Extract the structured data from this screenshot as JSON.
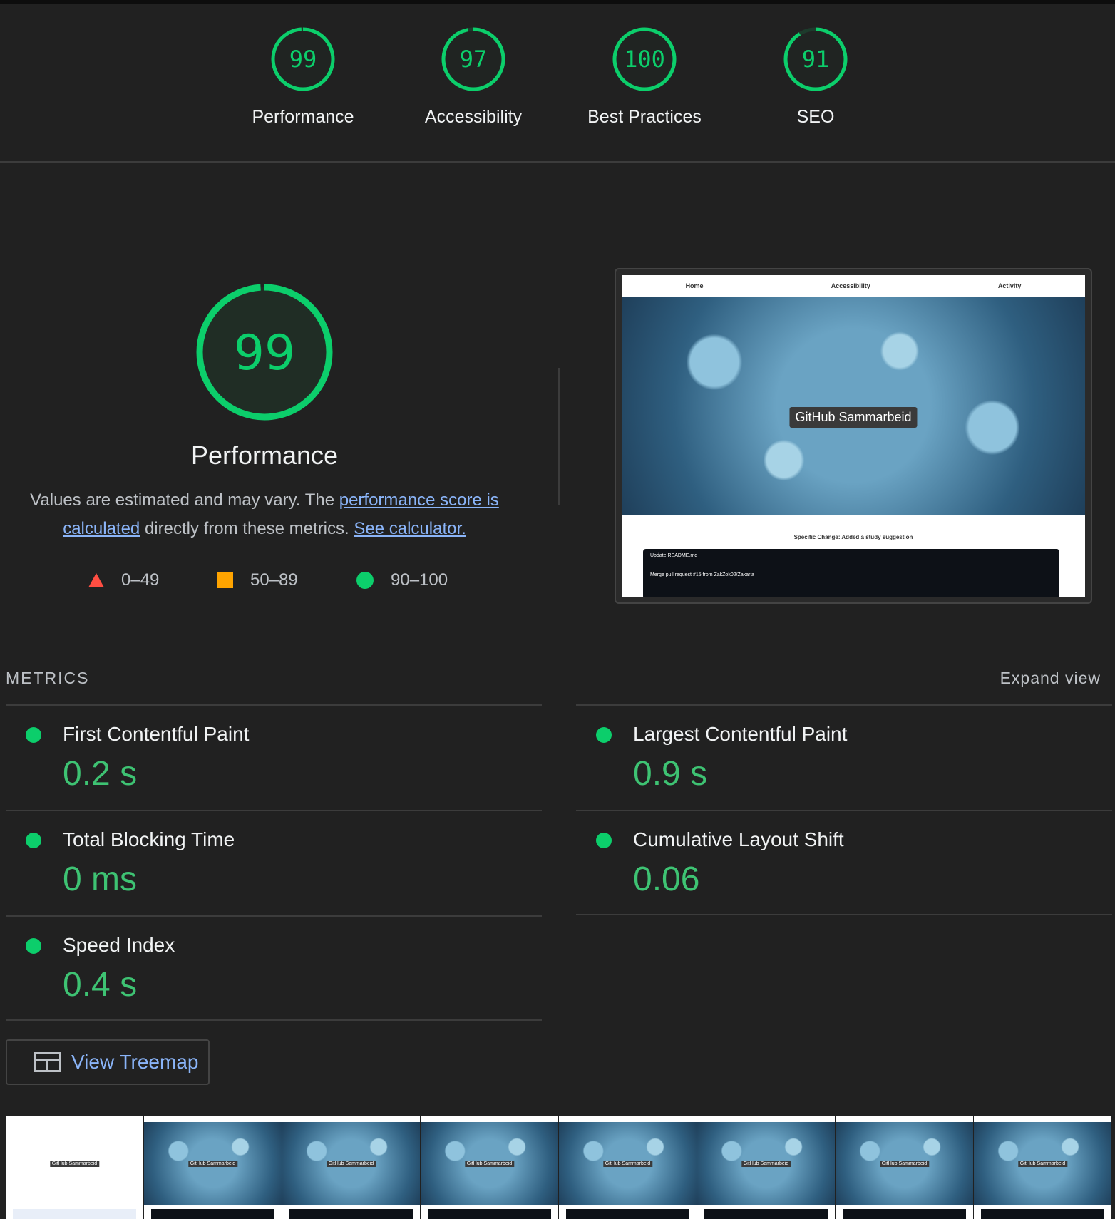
{
  "gauges": [
    {
      "score": "99",
      "label": "Performance",
      "value": 99
    },
    {
      "score": "97",
      "label": "Accessibility",
      "value": 97
    },
    {
      "score": "100",
      "label": "Best Practices",
      "value": 100
    },
    {
      "score": "91",
      "label": "SEO",
      "value": 91
    }
  ],
  "main": {
    "score": "99",
    "score_value": 99,
    "title": "Performance",
    "desc_prefix": "Values are estimated and may vary. The ",
    "desc_link1": "performance score is calculated",
    "desc_middle": " directly from these metrics. ",
    "desc_link2": "See calculator.",
    "legend": [
      {
        "shape": "triangle",
        "range": "0–49",
        "color": "#ff4e42"
      },
      {
        "shape": "square",
        "range": "50–89",
        "color": "#ffa400"
      },
      {
        "shape": "circle",
        "range": "90–100",
        "color": "#0cce6b"
      }
    ]
  },
  "screenshot": {
    "nav": [
      "Home",
      "Accessibility",
      "Activity"
    ],
    "hero_title": "GitHub Sammarbeid",
    "change_text": "Specific Change: Added a study suggestion",
    "commits": [
      "Update README.md",
      "Merge pull request #15 from ZakZok02/Zakaria"
    ]
  },
  "metrics": {
    "header": "METRICS",
    "expand": "Expand view",
    "left": [
      {
        "title": "First Contentful Paint",
        "value": "0.2 s"
      },
      {
        "title": "Total Blocking Time",
        "value": "0 ms"
      },
      {
        "title": "Speed Index",
        "value": "0.4 s"
      }
    ],
    "right": [
      {
        "title": "Largest Contentful Paint",
        "value": "0.9 s"
      },
      {
        "title": "Cumulative Layout Shift",
        "value": "0.06"
      }
    ]
  },
  "treemap_button": "View Treemap",
  "filmstrip_title": "GitHub Sammarbeid",
  "colors": {
    "pass": "#0cce6b",
    "pass_text": "#3ec373",
    "link": "#8ab4f8",
    "background": "#212121"
  }
}
